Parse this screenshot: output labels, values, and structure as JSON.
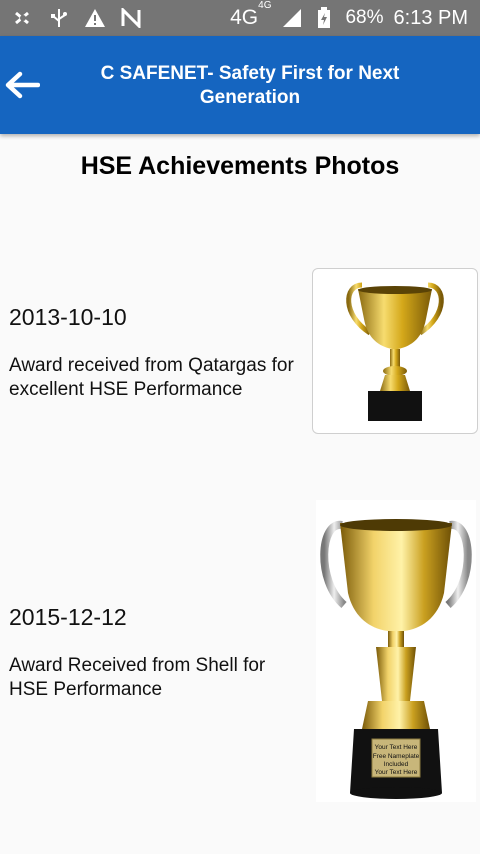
{
  "status_bar": {
    "network": "4G",
    "network_sup": "4G",
    "battery": "68%",
    "time": "6:13 PM",
    "icons": [
      "bluetooth-off-icon",
      "usb-icon",
      "warning-icon",
      "n-icon",
      "signal-icon",
      "battery-icon"
    ]
  },
  "app_bar": {
    "title": "C SAFENET- Safety First for Next Generation",
    "back_icon": "arrow-left-icon",
    "color": "#1565c0"
  },
  "page": {
    "title": "HSE Achievements Photos"
  },
  "achievements": [
    {
      "date": "2013-10-10",
      "description": "Award received from Qatargas for excellent HSE Performance",
      "image": "trophy-photo"
    },
    {
      "date": "2015-12-12",
      "description": "Award Received from Shell for HSE Performance",
      "image": "trophy-photo",
      "plate_text": [
        "Your Text Here",
        "Free Nameplate",
        "Included",
        "Your Text Here"
      ]
    }
  ]
}
